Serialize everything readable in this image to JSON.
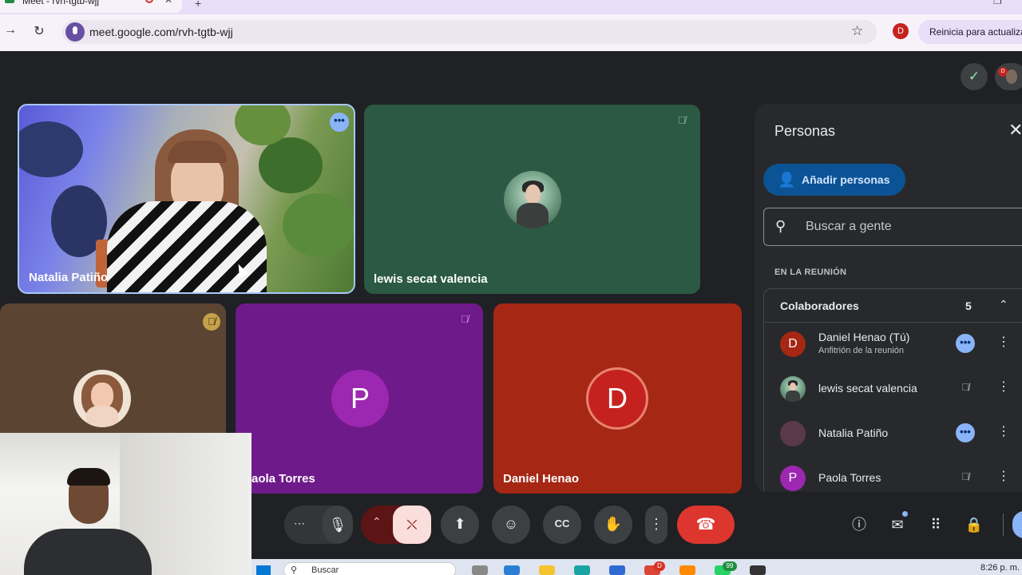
{
  "browser": {
    "tab_title": "Meet - rvh-tgtb-wjj",
    "url": "meet.google.com/rvh-tgtb-wjj",
    "profile_initial": "D",
    "update_button_label": "Reinicia para actualizar"
  },
  "meeting": {
    "tiles": [
      {
        "name": "Natalia Patiño"
      },
      {
        "name": "lewis secat valencia"
      },
      {
        "name": "Paola Torres",
        "initial": "P"
      },
      {
        "name": "Daniel Henao",
        "initial": "D"
      }
    ]
  },
  "panel": {
    "title": "Personas",
    "add_people_label": "Añadir personas",
    "search_placeholder": "Buscar a gente",
    "section_label": "EN LA REUNIÓN",
    "group": {
      "title": "Colaboradores",
      "count": "5"
    },
    "people": [
      {
        "name": "Daniel Henao (Tú)",
        "subtitle": "Anfitrión de la reunión",
        "initial": "D"
      },
      {
        "name": "lewis secat valencia"
      },
      {
        "name": "Natalia Patiño"
      },
      {
        "name": "Paola Torres",
        "initial": "P"
      }
    ]
  },
  "taskbar": {
    "search_placeholder": "Buscar",
    "badge_chrome": "D",
    "badge_whatsapp": "99",
    "clock": "8:26 p. m."
  },
  "colors": {
    "meet_bg": "#202124",
    "panel_bg": "#28292c",
    "leave_red": "#dc362e",
    "accent_blue": "#8ab4f8"
  }
}
